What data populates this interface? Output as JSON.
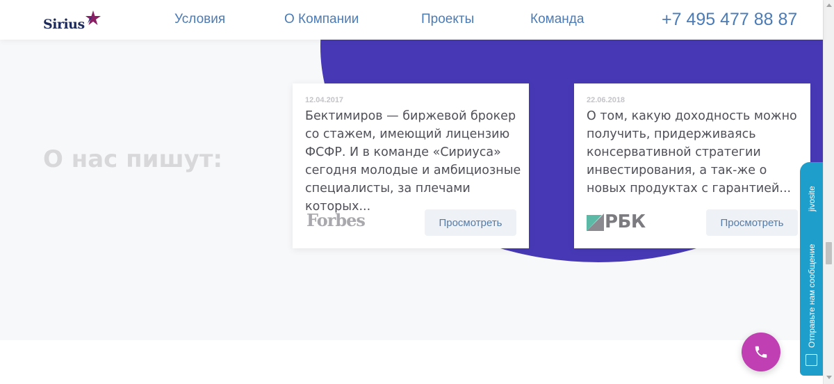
{
  "header": {
    "logo_text": "Sirius",
    "nav": [
      {
        "label": "Условия"
      },
      {
        "label": "О Компании"
      },
      {
        "label": "Проекты"
      },
      {
        "label": "Команда"
      }
    ],
    "phone": "+7 495 477 88 87"
  },
  "section": {
    "title": "О нас пишут:",
    "cards": [
      {
        "date": "12.04.2017",
        "text": "Бектимиров — биржевой брокер со стажем, имеющий лицензию ФСФР. И в команде «Сириуса» сегодня молодые и амбициозные специалисты, за плечами которых...",
        "source": "Forbes",
        "button": "Просмотреть"
      },
      {
        "date": "22.06.2018",
        "text": "О том, какую доходность можно получить, придерживаясь консервативной стратегии инвестирования, а так-же о новых продуктах с гарантией...",
        "source": "РБК",
        "button": "Просмотреть"
      }
    ]
  },
  "jivo": {
    "brand": "jivosite",
    "message": "Отправьте нам сообщение"
  },
  "colors": {
    "accent_blue": "#4a7bb7",
    "blob_purple": "#4739b5",
    "call_button": "#c03fb2",
    "jivo_blue": "#1e9ecb"
  },
  "icons": {
    "logo_star": "star-icon",
    "call": "phone-icon",
    "jivo": "chat-icon"
  }
}
